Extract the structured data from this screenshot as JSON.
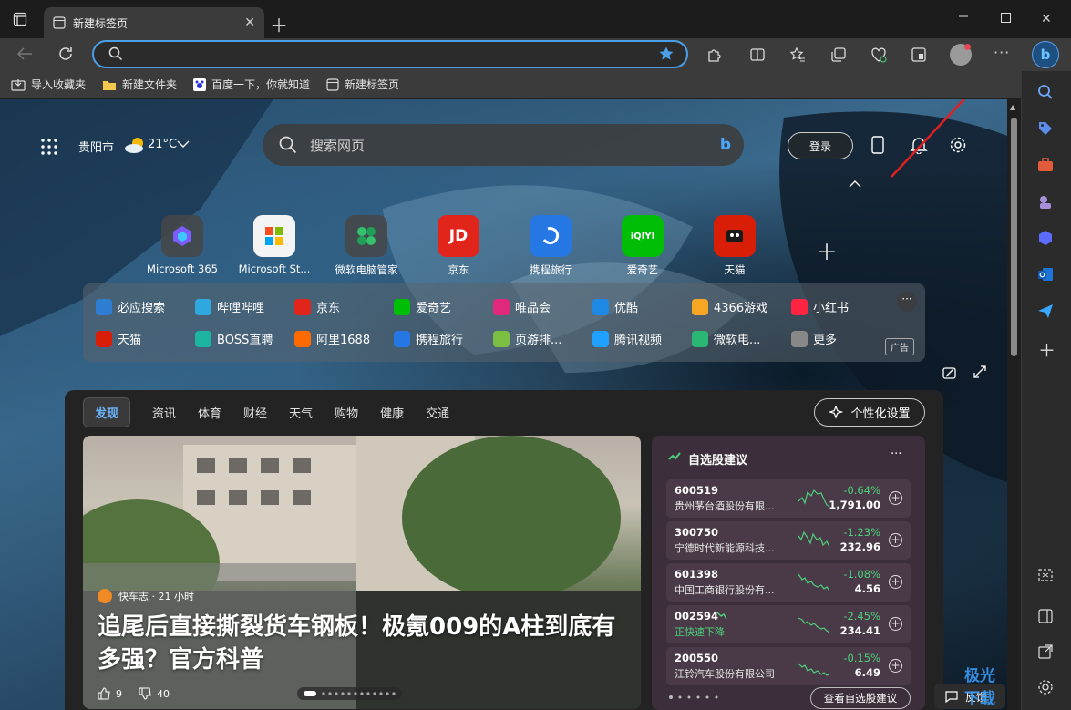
{
  "window": {
    "tab_title": "新建标签页"
  },
  "bookmarks": [
    {
      "label": "导入收藏夹"
    },
    {
      "label": "新建文件夹"
    },
    {
      "label": "百度一下，你就知道"
    },
    {
      "label": "新建标签页"
    }
  ],
  "weather": {
    "city": "贵阳市",
    "temp": "21°C"
  },
  "search": {
    "placeholder": "搜索网页"
  },
  "login": "登录",
  "tiles": [
    {
      "label": "Microsoft 365"
    },
    {
      "label": "Microsoft St..."
    },
    {
      "label": "微软电脑管家"
    },
    {
      "label": "京东"
    },
    {
      "label": "携程旅行"
    },
    {
      "label": "爱奇艺"
    },
    {
      "label": "天猫"
    }
  ],
  "quicklinks": {
    "row1": [
      {
        "label": "必应搜索",
        "color": "#2d7dd2"
      },
      {
        "label": "哔哩哔哩",
        "color": "#2fa8e0"
      },
      {
        "label": "京东",
        "color": "#e1251b"
      },
      {
        "label": "爱奇艺",
        "color": "#00be06"
      },
      {
        "label": "唯品会",
        "color": "#e0287d"
      },
      {
        "label": "优酷",
        "color": "#1e88e5"
      },
      {
        "label": "4366游戏",
        "color": "#f5a623"
      },
      {
        "label": "小红书",
        "color": "#ff2442"
      }
    ],
    "row2": [
      {
        "label": "天猫",
        "color": "#d81e06"
      },
      {
        "label": "BOSS直聘",
        "color": "#1eb5a0"
      },
      {
        "label": "阿里1688",
        "color": "#ff6a00"
      },
      {
        "label": "携程旅行",
        "color": "#2577e3"
      },
      {
        "label": "页游排...",
        "color": "#7bc043"
      },
      {
        "label": "腾讯视频",
        "color": "#20a0ff"
      },
      {
        "label": "微软电...",
        "color": "#2ab673"
      },
      {
        "label": "更多",
        "color": "#888888"
      }
    ],
    "ad": "广告"
  },
  "feed": {
    "tabs": [
      "发现",
      "资讯",
      "体育",
      "财经",
      "天气",
      "购物",
      "健康",
      "交通"
    ],
    "personalize": "个性化设置",
    "hero": {
      "source": "快车志 · 21 小时",
      "title": "追尾后直接撕裂货车钢板！极氪009的A柱到底有多强？官方科普",
      "likes": "9",
      "dislikes": "40"
    }
  },
  "stocks": {
    "title": "自选股建议",
    "items": [
      {
        "code": "600519",
        "name": "贵州茅台酒股份有限...",
        "change": "-0.64%",
        "price": "1,791.00"
      },
      {
        "code": "300750",
        "name": "宁德时代新能源科技...",
        "change": "-1.23%",
        "price": "232.96"
      },
      {
        "code": "601398",
        "name": "中国工商银行股份有...",
        "change": "-1.08%",
        "price": "4.56"
      },
      {
        "code": "002594",
        "name": "正快速下降",
        "change": "-2.45%",
        "price": "234.41"
      },
      {
        "code": "200550",
        "name": "江铃汽车股份有限公司",
        "change": "-0.15%",
        "price": "6.49"
      }
    ],
    "view_btn": "查看自选股建议"
  },
  "feedback": "反馈",
  "watermark": "极光下载站"
}
